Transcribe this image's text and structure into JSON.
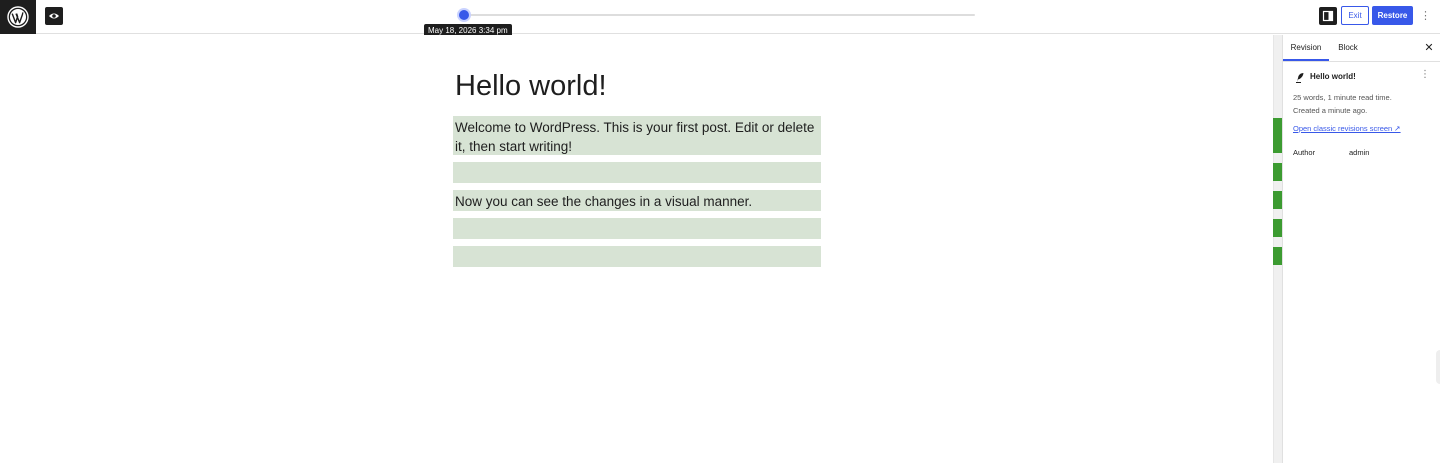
{
  "topbar": {
    "logo_icon": "wordpress-logo-icon",
    "preview_icon": "eye-icon",
    "slider": {
      "tooltip": "May 18, 2026 3:34 pm",
      "position_fraction": 0.0
    },
    "sidebar_toggle_icon": "sidebar-toggle-icon",
    "exit_label": "Exit",
    "restore_label": "Restore",
    "more_icon": "more-vertical-icon",
    "accent_color": "#3858e9"
  },
  "post": {
    "title": "Hello world!",
    "blocks": [
      "Welcome to WordPress. This is your first post. Edit or delete it, then start writing!",
      "",
      "Now you can see the changes in a visual manner.",
      "",
      ""
    ],
    "added_color": "#d7e3d4",
    "marker_color": "#3c9b31"
  },
  "sidebar": {
    "tabs": [
      "Revision",
      "Block"
    ],
    "close_icon": "close-icon",
    "revision_title": "Hello world!",
    "stats": "25 words, 1 minute read time.",
    "created": "Created a minute ago.",
    "classic_link": "Open classic revisions screen ↗",
    "author_label": "Author",
    "author_value": "admin"
  }
}
